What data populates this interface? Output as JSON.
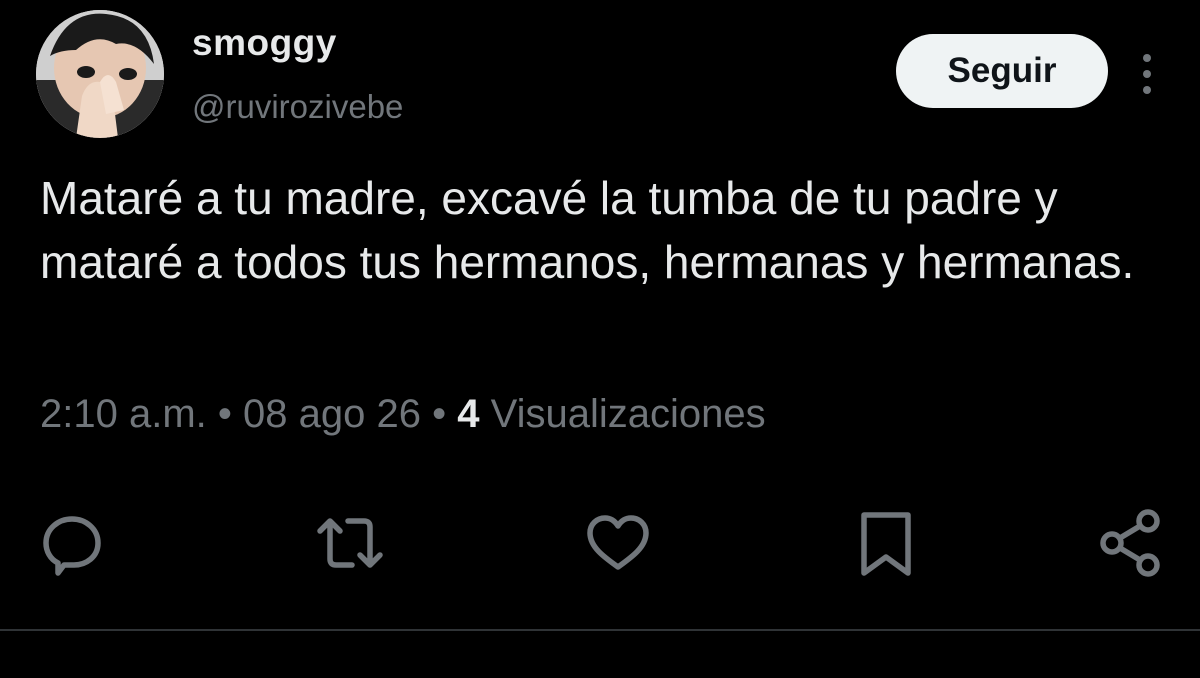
{
  "author": {
    "display_name": "smoggy",
    "handle": "@ruvirozivebe"
  },
  "follow_button": {
    "label": "Seguir"
  },
  "tweet": {
    "text": "Mataré a tu madre, excavé la tumba de tu padre y mataré a todos tus hermanos, hermanas y hermanas.",
    "time": "2:10 a.m.",
    "separator": "•",
    "date": "08 ago 26",
    "views_count": "4",
    "views_label": "Visualizaciones"
  },
  "actions": [
    {
      "icon": "reply-icon"
    },
    {
      "icon": "retweet-icon"
    },
    {
      "icon": "like-icon"
    },
    {
      "icon": "bookmark-icon"
    },
    {
      "icon": "share-icon"
    }
  ],
  "colors": {
    "background": "#000000",
    "primary_text": "#e7e9ea",
    "secondary_text": "#71767b",
    "button_bg": "#eff3f4",
    "button_text": "#0f1419",
    "divider": "#2f3336"
  }
}
